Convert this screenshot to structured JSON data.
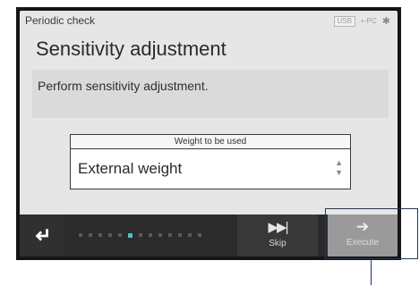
{
  "status": {
    "breadcrumb": "Periodic check",
    "usb_label": "USB",
    "pc_label": "PC",
    "bt_icon": "bluetooth-icon"
  },
  "title": "Sensitivity adjustment",
  "message": "Perform sensitivity adjustment.",
  "weight": {
    "header": "Weight to be used",
    "value": "External weight",
    "arrows_icon": "up-down-arrows-icon"
  },
  "progress": {
    "total": 13,
    "current": 6
  },
  "buttons": {
    "back_icon": "return-arrow-icon",
    "skip_icon": "skip-forward-icon",
    "skip_label": "Skip",
    "execute_icon": "right-arrow-icon",
    "execute_label": "Execute"
  },
  "colors": {
    "accent": "#4fc3c7",
    "bar": "#2b2b2b",
    "execute_disabled": "#9a9a9a",
    "callout": "#1f3a5a"
  }
}
